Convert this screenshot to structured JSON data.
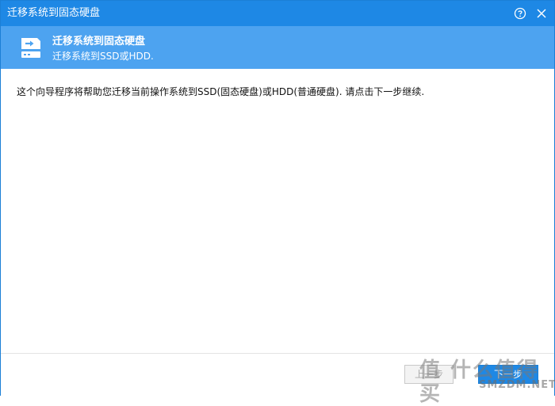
{
  "window": {
    "title": "迁移系统到固态硬盘",
    "help_icon": "help-icon",
    "close_icon": "close-icon",
    "accent_color": "#1e88e5",
    "banner_color": "#4da3f0"
  },
  "banner": {
    "title": "迁移系统到固态硬盘",
    "subtitle": "迁移系统到SSD或HDD.",
    "icon": "drive-arrow-icon"
  },
  "content": {
    "description": "这个向导程序将帮助您迁移当前操作系统到SSD(固态硬盘)或HDD(普通硬盘). 请点击下一步继续."
  },
  "footer": {
    "prev_label": "上一步",
    "next_label": "下一步"
  },
  "watermark": {
    "text": "值 什么值得买",
    "site": "SMZDM.NET"
  }
}
